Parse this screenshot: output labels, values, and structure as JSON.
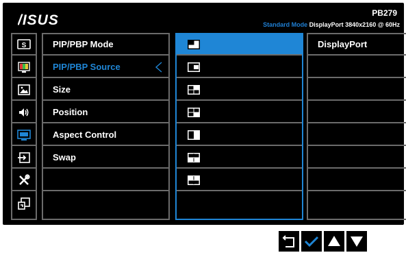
{
  "header": {
    "brand": "ASUS",
    "model": "PB279",
    "mode_label": "Standard  Mode",
    "input": "DisplayPort",
    "resolution": "3840x2160 @ 60Hz"
  },
  "colors": {
    "accent": "#1f86d6",
    "border": "#6b6b6b",
    "background": "#000000"
  },
  "icons": [
    {
      "name": "splendid-icon",
      "active": false
    },
    {
      "name": "color-icon",
      "active": false
    },
    {
      "name": "image-icon",
      "active": false
    },
    {
      "name": "sound-icon",
      "active": false
    },
    {
      "name": "pip-pbp-icon",
      "active": true
    },
    {
      "name": "input-select-icon",
      "active": false
    },
    {
      "name": "system-setup-icon",
      "active": false
    },
    {
      "name": "shortcut-icon",
      "active": false
    }
  ],
  "menu": [
    {
      "label": "PIP/PBP Mode",
      "selected": false
    },
    {
      "label": "PIP/PBP Source",
      "selected": true
    },
    {
      "label": "Size",
      "selected": false
    },
    {
      "label": "Position",
      "selected": false
    },
    {
      "label": "Aspect Control",
      "selected": false
    },
    {
      "label": "Swap",
      "selected": false
    },
    {
      "label": "",
      "selected": false
    },
    {
      "label": "",
      "selected": false
    }
  ],
  "sources": [
    {
      "icon": "layout-topleft-icon",
      "active": true
    },
    {
      "icon": "layout-right-icon",
      "active": false
    },
    {
      "icon": "layout-quad-tr-icon",
      "active": false
    },
    {
      "icon": "layout-quad-br-icon",
      "active": false
    },
    {
      "icon": "layout-leftright-icon",
      "active": false
    },
    {
      "icon": "layout-quad-bl-icon",
      "active": false
    },
    {
      "icon": "layout-quad-tl-icon",
      "active": false
    },
    {
      "icon": "",
      "active": false
    }
  ],
  "values": [
    "DisplayPort",
    "",
    "",
    "",
    "",
    "",
    "",
    ""
  ],
  "buttons": [
    "back-icon",
    "confirm-icon",
    "up-icon",
    "down-icon"
  ]
}
